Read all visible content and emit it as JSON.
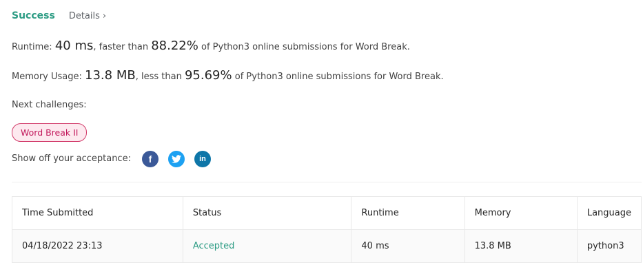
{
  "header": {
    "status": "Success",
    "details_label": "Details",
    "details_chevron": "›"
  },
  "runtime": {
    "label": "Runtime:",
    "value": "40 ms",
    "comparison_prefix": ", faster than",
    "percent": "88.22%",
    "suffix": "of Python3 online submissions for Word Break."
  },
  "memory": {
    "label": "Memory Usage:",
    "value": "13.8 MB",
    "comparison_prefix": ", less than",
    "percent": "95.69%",
    "suffix": "of Python3 online submissions for Word Break."
  },
  "next": {
    "label": "Next challenges:",
    "challenge": "Word Break II"
  },
  "share": {
    "label": "Show off your acceptance:",
    "icons": {
      "facebook": "f",
      "twitter": "t",
      "linkedin": "in"
    }
  },
  "table": {
    "headers": [
      "Time Submitted",
      "Status",
      "Runtime",
      "Memory",
      "Language"
    ],
    "rows": [
      [
        "04/18/2022 23:13",
        "Accepted",
        "40 ms",
        "13.8 MB",
        "python3"
      ]
    ]
  },
  "colors": {
    "accent": "#2d9c84",
    "chip_border": "#d23b6a",
    "chip_bg": "#fde9ef",
    "facebook": "#3b5998",
    "twitter": "#1da1f2",
    "linkedin": "#0e76a8"
  }
}
